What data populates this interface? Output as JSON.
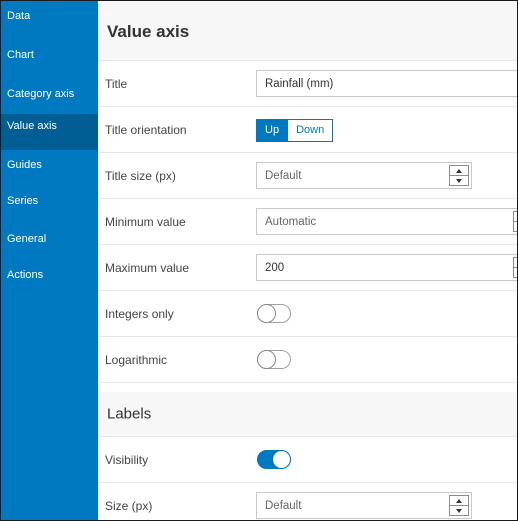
{
  "sidebar": {
    "items": [
      {
        "label": "Data",
        "active": false
      },
      {
        "label": "Chart",
        "active": false
      },
      {
        "label": "Category axis",
        "active": false
      },
      {
        "label": "Value axis",
        "active": true
      },
      {
        "label": "Guides",
        "active": false
      },
      {
        "label": "Series",
        "active": false
      },
      {
        "label": "General",
        "active": false
      },
      {
        "label": "Actions",
        "active": false
      }
    ]
  },
  "header": {
    "title": "Value axis"
  },
  "rows": {
    "title": {
      "label": "Title",
      "value": "Rainfall (mm)"
    },
    "orientation": {
      "label": "Title orientation",
      "options": [
        "Up",
        "Down"
      ],
      "selected": "Up"
    },
    "title_size": {
      "label": "Title size (px)",
      "value": "Default"
    },
    "min_value": {
      "label": "Minimum value",
      "value": "Automatic"
    },
    "max_value": {
      "label": "Maximum value",
      "value": "200"
    },
    "integers_only": {
      "label": "Integers only",
      "checked": false
    },
    "logarithmic": {
      "label": "Logarithmic",
      "checked": false
    }
  },
  "labels_section": {
    "title": "Labels",
    "visibility": {
      "label": "Visibility",
      "checked": true
    },
    "size": {
      "label": "Size (px)",
      "value": "Default"
    }
  },
  "colors": {
    "accent": "#0079c1",
    "accent_active": "#005e95"
  }
}
